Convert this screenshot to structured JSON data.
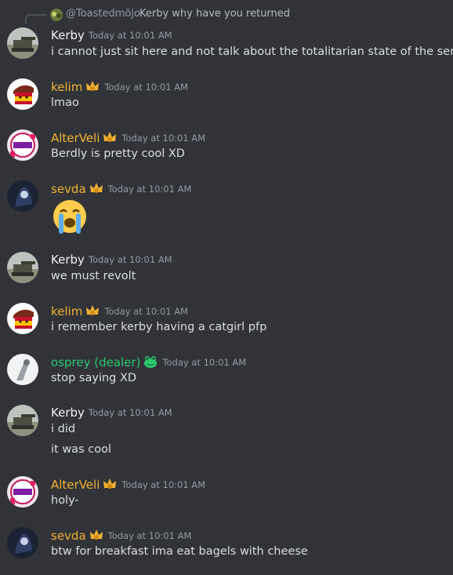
{
  "reply": {
    "author": "@Toastedmõjo",
    "text": "Kerby why have you returned"
  },
  "messages": [
    {
      "author": "Kerby",
      "time": "Today at 10:01 AM",
      "lines": [
        "i cannot just sit here and not talk about the totalitarian state of the server"
      ]
    },
    {
      "author": "kelim",
      "time": "Today at 10:01 AM",
      "lines": [
        "lmao"
      ]
    },
    {
      "author": "AlterVeli",
      "time": "Today at 10:01 AM",
      "lines": [
        "Berdly is pretty cool XD"
      ]
    },
    {
      "author": "sevda",
      "time": "Today at 10:01 AM",
      "lines": [],
      "emoji": "loudly-crying-face"
    },
    {
      "author": "Kerby",
      "time": "Today at 10:01 AM",
      "lines": [
        "we must revolt"
      ]
    },
    {
      "author": "kelim",
      "time": "Today at 10:01 AM",
      "lines": [
        "i remember kerby having a catgirl pfp"
      ]
    },
    {
      "author": "osprey (dealer)",
      "time": "Today at 10:01 AM",
      "lines": [
        "stop saying XD"
      ]
    },
    {
      "author": "Kerby",
      "time": "Today at 10:01 AM",
      "lines": [
        "i did",
        "it was cool"
      ]
    },
    {
      "author": "AlterVeli",
      "time": "Today at 10:01 AM",
      "lines": [
        "holy-"
      ]
    },
    {
      "author": "sevda",
      "time": "Today at 10:01 AM",
      "lines": [
        "btw for breakfast ima eat bagels with cheese"
      ]
    }
  ],
  "colors": {
    "background": "#313338",
    "role_yellow": "#f0b232",
    "role_green": "#2dc770",
    "text": "#dbdee1",
    "timestamp": "#949ba4"
  }
}
